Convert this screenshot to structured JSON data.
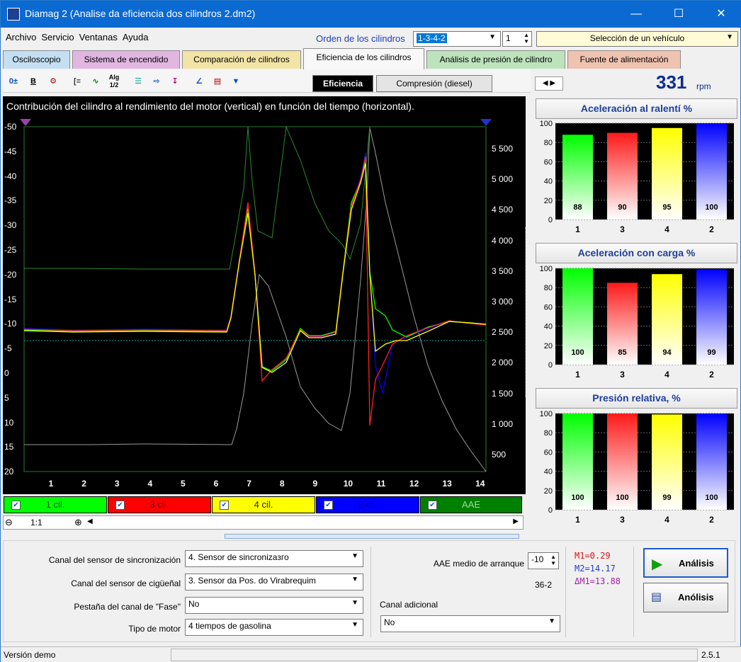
{
  "window": {
    "title": "Diamag 2 (Analise da eficiencia dos cilindros 2.dm2)"
  },
  "menu": [
    "Archivo",
    "Servicio",
    "Ventanas",
    "Ayuda"
  ],
  "order": {
    "label": "Orden de los cilindros",
    "value": "1-3-4-2",
    "spin": "1"
  },
  "vehicle": {
    "value": "Selección de un vehículo"
  },
  "tabs": [
    "Osciloscopio",
    "Sistema de encendido",
    "Comparación de cilindros",
    "Eficiencia de los cilindros",
    "Análisis de presión de cilindro",
    "Fuente de alimentación"
  ],
  "subtabs": [
    "Eficiencia",
    "Compresión (diesel)"
  ],
  "rpm": {
    "value": "331",
    "unit": "rpm"
  },
  "scope": {
    "title": "Contribución del cilindro al rendimiento del motor (vertical) en función del tiempo (horizontal).",
    "left_ticks": [
      "-50",
      "-45",
      "-40",
      "-35",
      "-30",
      "-25",
      "-20",
      "-15",
      "-10",
      "-5",
      "0",
      "5",
      "10",
      "15",
      "20"
    ],
    "right_ticks": [
      "5 500",
      "5 000",
      "4 500",
      "4 000",
      "3 500",
      "3 000",
      "2 500",
      "2 000",
      "1 500",
      "1 000",
      "500"
    ],
    "x_ticks": [
      "1",
      "2",
      "3",
      "4",
      "5",
      "6",
      "7",
      "8",
      "9",
      "10",
      "11",
      "12",
      "13",
      "14"
    ]
  },
  "legend": [
    {
      "label": "1 cil.",
      "color": "#00ff00"
    },
    {
      "label": "3 cil.",
      "color": "#ff0000"
    },
    {
      "label": "4 cil.",
      "color": "#ffff00"
    },
    {
      "label": "2 cil.",
      "color": "#0000ff"
    },
    {
      "label": "AAE",
      "color": "#008000"
    }
  ],
  "zoom": {
    "level": "1:1"
  },
  "chart_data": [
    {
      "type": "bar",
      "title": "Aceleración al ralentí %",
      "categories": [
        "1",
        "3",
        "4",
        "2"
      ],
      "values": [
        88,
        90,
        95,
        100
      ],
      "ylim": [
        0,
        100
      ],
      "y_ticks": [
        "0",
        "20",
        "40",
        "60",
        "80",
        "100"
      ]
    },
    {
      "type": "bar",
      "title": "Aceleración con carga %",
      "categories": [
        "1",
        "3",
        "4",
        "2"
      ],
      "values": [
        100,
        85,
        94,
        99
      ],
      "ylim": [
        0,
        100
      ],
      "y_ticks": [
        "0",
        "20",
        "40",
        "60",
        "80",
        "100"
      ]
    },
    {
      "type": "bar",
      "title": "Presión relativa, %",
      "categories": [
        "1",
        "3",
        "4",
        "2"
      ],
      "values": [
        100,
        100,
        99,
        100
      ],
      "ylim": [
        0,
        100
      ],
      "y_ticks": [
        "0",
        "20",
        "40",
        "60",
        "80",
        "100"
      ]
    }
  ],
  "bar_colors": [
    "#00ff00",
    "#ff1a1a",
    "#ffff00",
    "#0000ff"
  ],
  "form": {
    "sync_label": "Canal del sensor de sincronización",
    "sync_value": "4.  Sensor de sincronizaзго",
    "crank_label": "Canal del sensor de cigüeñal",
    "crank_value": "3.  Sensor da Pos. do Virabrequim",
    "phase_label": "Pestaña del canal de \"Fase\"",
    "phase_value": "No",
    "motor_label": "Tipo de motor",
    "motor_value": "4 tiempos de gasolina",
    "aae_label": "AAE medio de arranque",
    "aae_value": "-10",
    "teeth": "36-2",
    "extra_label": "Canal adicional",
    "extra_value": "No",
    "m1": "M1=0.29",
    "m2": "M2=14.17",
    "dm1": "ΔM1=13.88",
    "analysis_btn": "Análisis",
    "analysis2_btn": "Anólisis"
  },
  "status": {
    "left": "Versión demo",
    "right": "2.5.1"
  }
}
